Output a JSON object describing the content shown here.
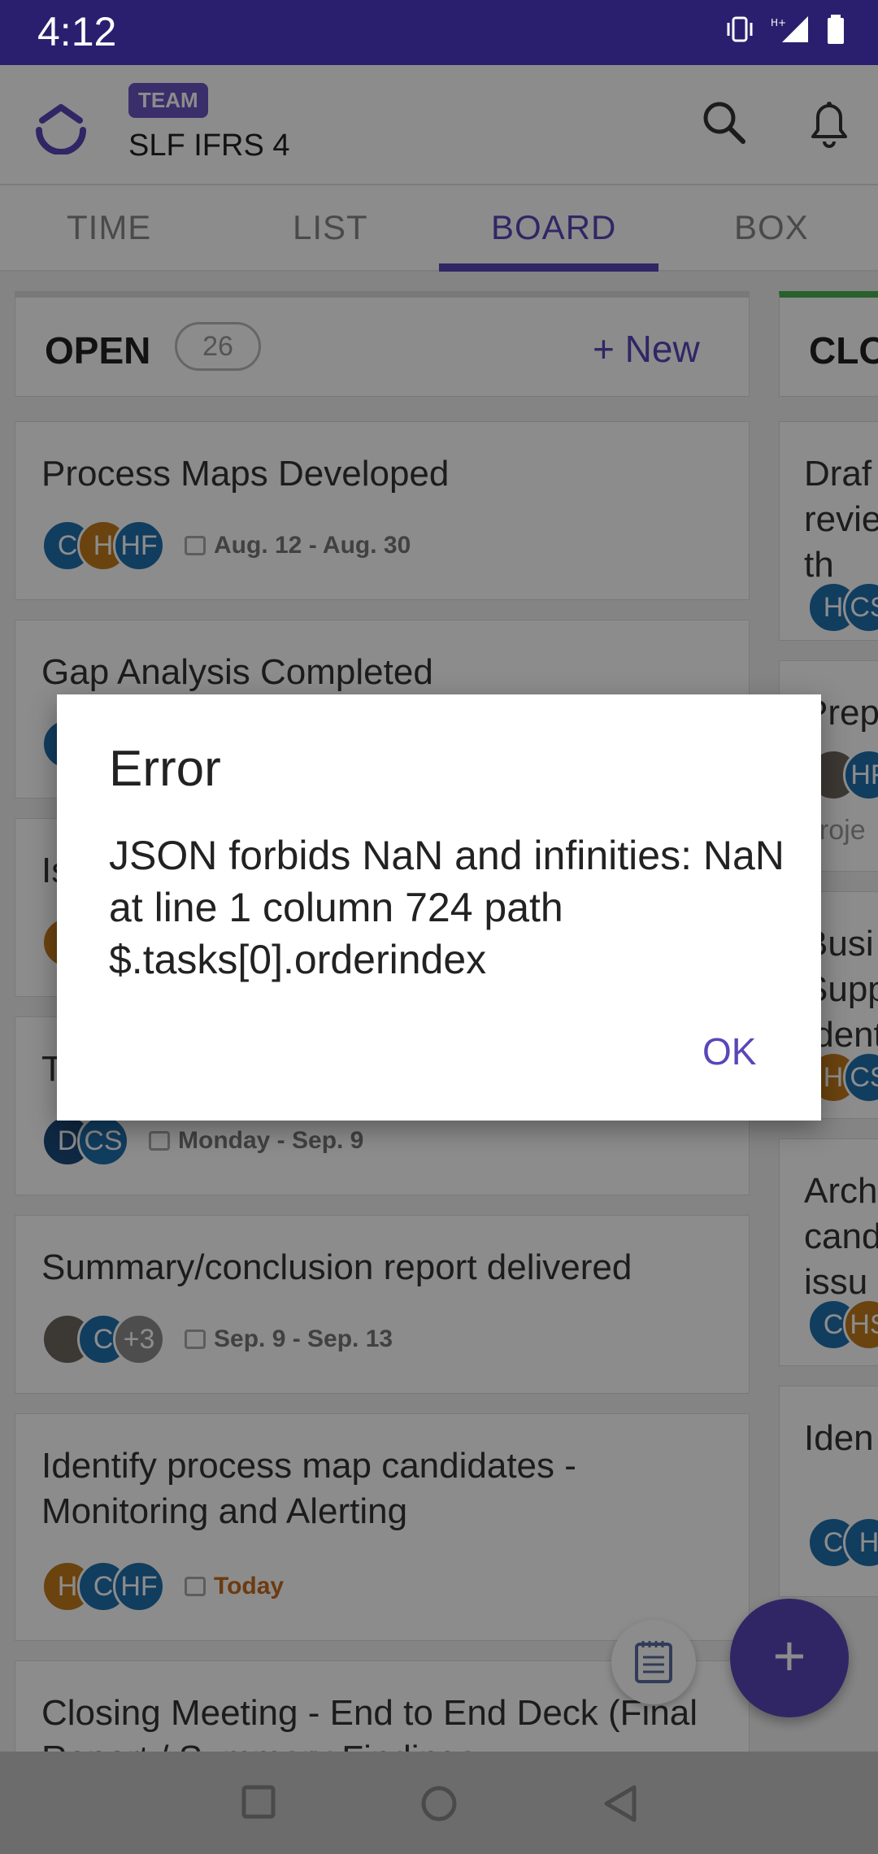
{
  "status": {
    "time": "4:12"
  },
  "header": {
    "badge": "TEAM",
    "team_name": "SLF IFRS 4"
  },
  "tabs": [
    {
      "label": "TIME"
    },
    {
      "label": "LIST"
    },
    {
      "label": "BOARD",
      "active": true
    },
    {
      "label": "BOX"
    }
  ],
  "column_open": {
    "title": "OPEN",
    "count": "26",
    "new_label": "+ New"
  },
  "cards": [
    {
      "title": "Process Maps Developed",
      "avatars": [
        "C",
        "H",
        "HF"
      ],
      "date": "Aug. 12 - Aug. 30"
    },
    {
      "title": "Gap Analysis Completed"
    },
    {
      "title": "Is"
    },
    {
      "title": "T",
      "avatars": [
        "D",
        "CS"
      ],
      "date": "Monday - Sep. 9"
    },
    {
      "title": "Summary/conclusion report delivered",
      "avatars": [
        "",
        "C",
        "+3"
      ],
      "date": "Sep. 9 - Sep. 13"
    },
    {
      "title": "Identify process map candidates - Monitoring and Alerting",
      "avatars": [
        "H",
        "C",
        "HF"
      ],
      "date": "Today"
    },
    {
      "title": "Closing Meeting - End to End Deck (Final Report / Summary Findings"
    }
  ],
  "column_closed": {
    "title": "CLO",
    "cards": [
      {
        "title": "Draf revie on th",
        "avatars": [
          "H",
          "CS"
        ]
      },
      {
        "title": "Prep",
        "sub": "proje",
        "avatars": [
          "",
          "HF"
        ]
      },
      {
        "title": "Busi Supp Ident",
        "avatars": [
          "H",
          "CS"
        ]
      },
      {
        "title": "Arch cand issu",
        "avatars": [
          "C",
          "HS"
        ]
      },
      {
        "title": "Iden sa",
        "avatars": [
          "C",
          "H"
        ]
      }
    ]
  },
  "dialog": {
    "title": "Error",
    "message": "JSON forbids NaN and infinities: NaN at line 1 column 724 path $.tasks[0].orderindex",
    "ok_label": "OK"
  },
  "colors": {
    "accent": "#5a46b8",
    "statusbar": "#2a1f6e",
    "today": "#c66a1e"
  }
}
